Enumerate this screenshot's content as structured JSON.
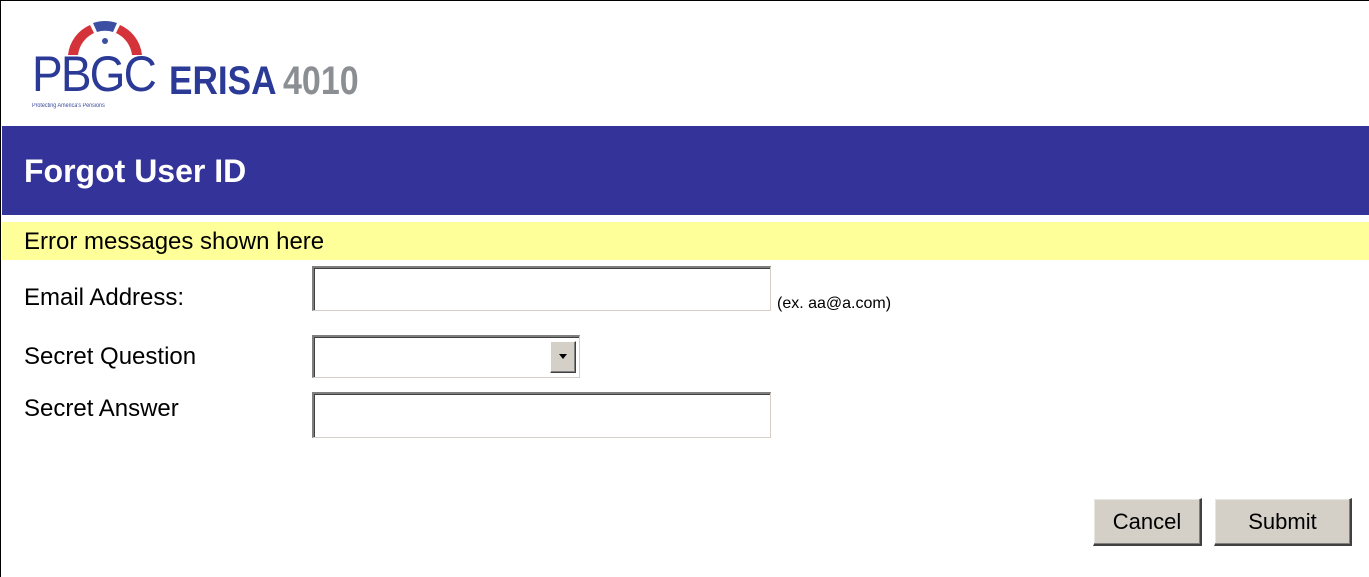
{
  "logo": {
    "pbgc": "PBGC",
    "product": "ERISA",
    "number": "4010",
    "tagline": "Protecting America's Pensions",
    "colors": {
      "navy": "#2b3a96",
      "gray": "#8b8f94",
      "arch_red": "#d4333a",
      "arch_blue": "#3c4fa3"
    }
  },
  "header": {
    "title": "Forgot User ID",
    "background": "#333399"
  },
  "error_bar": {
    "message": "Error messages shown here",
    "background": "#ffff99"
  },
  "form": {
    "email": {
      "label": "Email Address:",
      "value": "",
      "hint": "(ex. aa@a.com)"
    },
    "secret_question": {
      "label": "Secret Question",
      "selected": "",
      "icon": "chevron-down-icon"
    },
    "secret_answer": {
      "label": "Secret Answer",
      "value": ""
    }
  },
  "actions": {
    "cancel_label": "Cancel",
    "submit_label": "Submit"
  }
}
